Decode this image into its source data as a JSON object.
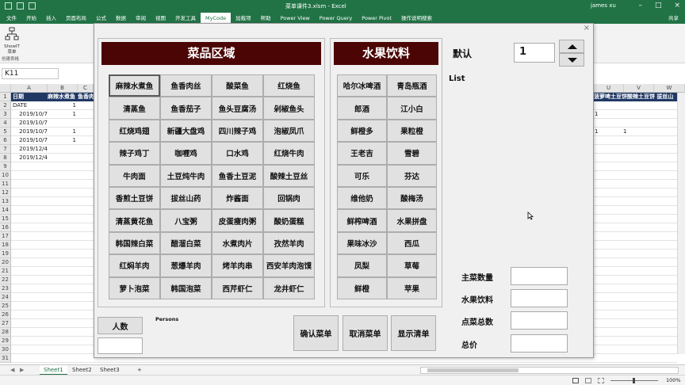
{
  "titlebar": {
    "title": "菜单课件3.xlsm - Excel",
    "user": "james xu"
  },
  "menu": {
    "tabs": [
      "文件",
      "开始",
      "插入",
      "页面布局",
      "公式",
      "数据",
      "审阅",
      "视图",
      "开发工具",
      "MyCode",
      "加载项",
      "帮助",
      "Power View",
      "Power Query",
      "Power Pivot",
      "操作说明搜索"
    ],
    "active": "MyCode",
    "share": "共享"
  },
  "ribbon": {
    "button_label": "ShowIT\n菜单",
    "group_label": "创建表格"
  },
  "name_box": "K11",
  "grid": {
    "columns": [
      "A",
      "B",
      "C",
      "U",
      "V",
      "W"
    ],
    "row_numbers": [
      "1",
      "2",
      "3",
      "4",
      "5",
      "6",
      "7",
      "8",
      "9",
      "10",
      "11",
      "12",
      "13",
      "14",
      "15",
      "16",
      "17",
      "18",
      "19",
      "20",
      "21",
      "22",
      "23",
      "24",
      "25",
      "26",
      "27",
      "28",
      "29",
      "30",
      "31"
    ],
    "left_header": {
      "a": "日期",
      "b": "麻辣水煮鱼",
      "c": "鱼香肉"
    },
    "right_header": "菠萝啤土豆饼酸辣土豆饼 拔丝山",
    "rows": [
      {
        "a": "DATE",
        "b": "1"
      },
      {
        "a": "2019/10/7",
        "b": "1"
      },
      {
        "a": "2019/10/7",
        "b": ""
      },
      {
        "a": "2019/10/7",
        "b": "1"
      },
      {
        "a": "2019/10/7",
        "b": "1"
      },
      {
        "a": "2019/12/4",
        "b": ""
      },
      {
        "a": "2019/12/4",
        "b": ""
      }
    ],
    "right_values": [
      {
        "u": "1",
        "v": ""
      },
      {
        "u": "1",
        "v": "1"
      }
    ]
  },
  "sheets": {
    "tabs": [
      "Sheet1",
      "Sheet2",
      "Sheet3"
    ],
    "active": "Sheet1",
    "add": "+"
  },
  "status": {
    "zoom": "100%"
  },
  "form": {
    "dish_title": "菜品区域",
    "drink_title": "水果饮料",
    "dishes": [
      "麻辣水煮鱼",
      "鱼香肉丝",
      "酸菜鱼",
      "红烧鱼",
      "清蒸鱼",
      "鱼香茄子",
      "鱼头豆腐汤",
      "剁椒鱼头",
      "红烧鸡翅",
      "新疆大盘鸡",
      "四川辣子鸡",
      "泡椒凤爪",
      "辣子鸡丁",
      "咖喱鸡",
      "口水鸡",
      "红烧牛肉",
      "牛肉面",
      "土豆炖牛肉",
      "鱼香土豆泥",
      "酸辣土豆丝",
      "香煎土豆饼",
      "拔丝山药",
      "炸酱面",
      "回锅肉",
      "清蒸黄花鱼",
      "八宝粥",
      "皮蛋瘦肉粥",
      "酸奶蛋糕",
      "韩国辣白菜",
      "醋溜白菜",
      "水煮肉片",
      "孜然羊肉",
      "红焖羊肉",
      "葱爆羊肉",
      "烤羊肉串",
      "西安羊肉泡馍",
      "萝卜泡菜",
      "韩国泡菜",
      "西芹虾仁",
      "龙井虾仁"
    ],
    "drinks": [
      "哈尔冰啤酒",
      "青岛瓶酒",
      "郎酒",
      "江小白",
      "鲜橙多",
      "果粒橙",
      "王老吉",
      "雪碧",
      "可乐",
      "芬达",
      "维他奶",
      "酸梅汤",
      "鲜榨啤酒",
      "水果拼盘",
      "果味冰沙",
      "西瓜",
      "凤梨",
      "草莓",
      "鲜橙",
      "苹果"
    ],
    "default_label": "默认",
    "default_value": "1",
    "list_label": "List",
    "persons_button": "人数",
    "persons_caption": "Persons",
    "confirm_button": "确认菜单",
    "cancel_button": "取消菜单",
    "show_button": "显示清单",
    "stats": [
      "主菜数量",
      "水果饮料",
      "点菜总数",
      "总价"
    ],
    "close": "×"
  },
  "colors": {
    "excel_green": "#217346",
    "banner": "#4b0505",
    "header_fill": "#203864"
  }
}
